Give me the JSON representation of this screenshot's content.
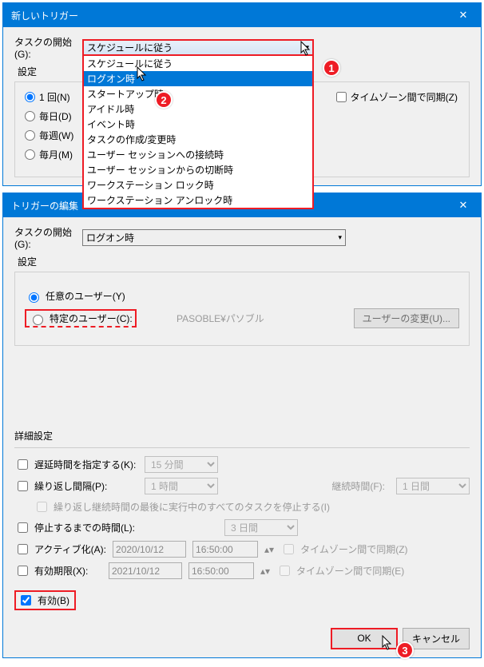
{
  "dialog1": {
    "title": "新しいトリガー",
    "task_begin_label": "タスクの開始(G):",
    "combo_value": "スケジュールに従う",
    "settings_label": "設定",
    "dropdown": [
      "スケジュールに従う",
      "ログオン時",
      "スタートアップ時",
      "アイドル時",
      "イベント時",
      "タスクの作成/変更時",
      "ユーザー セッションへの接続時",
      "ユーザー セッションからの切断時",
      "ワークステーション ロック時",
      "ワークステーション アンロック時"
    ],
    "radios": {
      "once": "1 回(N)",
      "daily": "毎日(D)",
      "weekly": "毎週(W)",
      "monthly": "毎月(M)"
    },
    "tz_sync": "タイムゾーン間で同期(Z)"
  },
  "dialog2": {
    "title": "トリガーの編集",
    "task_begin_label": "タスクの開始(G):",
    "combo_value": "ログオン時",
    "settings_label": "設定",
    "any_user": "任意のユーザー(Y)",
    "specific_user": "特定のユーザー(C):",
    "username": "PASOBLE¥パソブル",
    "change_user_btn": "ユーザーの変更(U)...",
    "advanced_label": "詳細設定",
    "delay_label": "遅延時間を指定する(K):",
    "delay_val": "15 分間",
    "repeat_label": "繰り返し間隔(P):",
    "repeat_val": "1 時間",
    "duration_label": "継続時間(F):",
    "duration_val": "1 日間",
    "stop_all_label": "繰り返し継続時間の最後に実行中のすべてのタスクを停止する(I)",
    "stop_after_label": "停止するまでの時間(L):",
    "stop_after_val": "3 日間",
    "activate_label": "アクティブ化(A):",
    "activate_date": "2020/10/12",
    "activate_time": "16:50:00",
    "tz_sync_z": "タイムゾーン間で同期(Z)",
    "expire_label": "有効期限(X):",
    "expire_date": "2021/10/12",
    "expire_time": "16:50:00",
    "tz_sync_e": "タイムゾーン間で同期(E)",
    "enabled_label": "有効(B)",
    "ok_btn": "OK",
    "cancel_btn": "キャンセル"
  },
  "badges": {
    "b1": "1",
    "b2": "2",
    "b3": "3"
  }
}
